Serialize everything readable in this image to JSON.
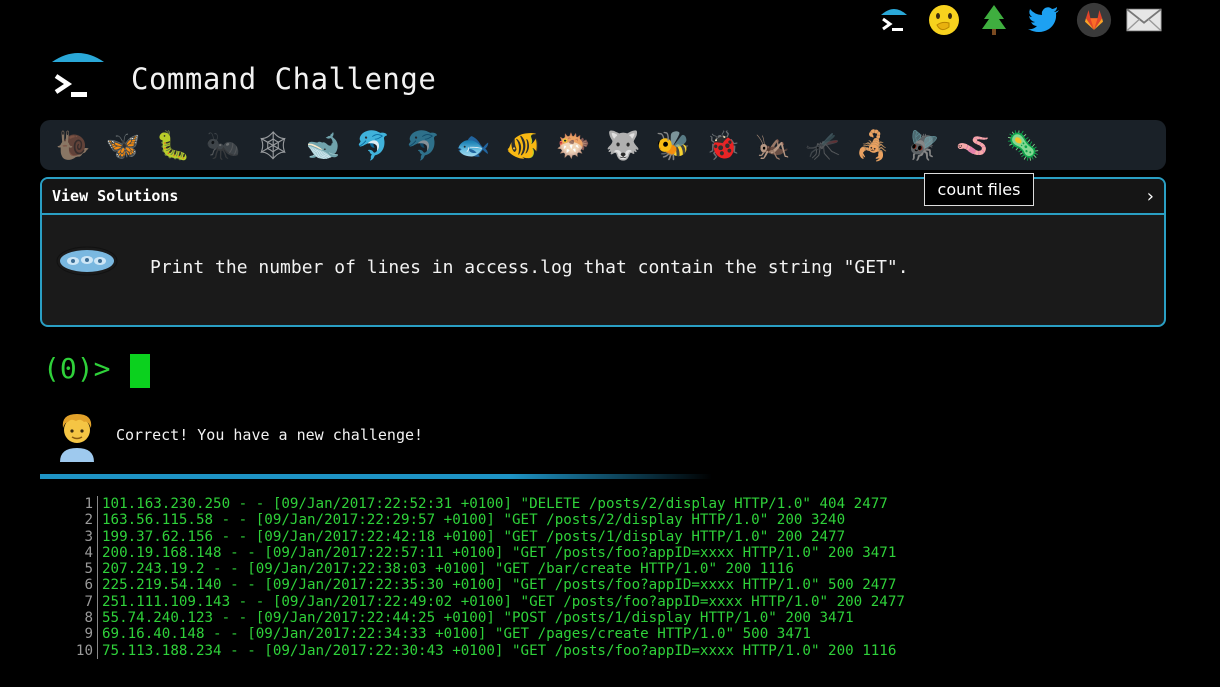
{
  "header": {
    "title": "Command Challenge"
  },
  "top_icons": [
    "terminal-icon",
    "face-with-hand-over-mouth-icon",
    "tree-icon",
    "twitter-icon",
    "gitlab-icon",
    "mail-icon"
  ],
  "animals": [
    "snail",
    "butterfly",
    "bug",
    "ant",
    "spider-web",
    "whale",
    "dolphin",
    "dolphin",
    "fish",
    "tropical-fish",
    "blowfish",
    "wolf",
    "bee",
    "ladybug",
    "cricket",
    "mosquito",
    "scorpion",
    "fly",
    "worm",
    "microbe"
  ],
  "solutions": {
    "label": "View Solutions",
    "chevron": "›",
    "tooltip": "count files"
  },
  "challenge": {
    "text": "Print the number of lines in access.log that contain the string \"GET\"."
  },
  "terminal": {
    "prompt": "(0)>"
  },
  "message": {
    "text": "Correct! You have a new challenge!"
  },
  "log_lines": [
    {
      "n": "1",
      "text": "101.163.230.250 - - [09/Jan/2017:22:52:31 +0100] \"DELETE /posts/2/display HTTP/1.0\" 404 2477"
    },
    {
      "n": "2",
      "text": "163.56.115.58 - - [09/Jan/2017:22:29:57 +0100] \"GET /posts/2/display HTTP/1.0\" 200 3240"
    },
    {
      "n": "3",
      "text": "199.37.62.156 - - [09/Jan/2017:22:42:18 +0100] \"GET /posts/1/display HTTP/1.0\" 200 2477"
    },
    {
      "n": "4",
      "text": "200.19.168.148 - - [09/Jan/2017:22:57:11 +0100] \"GET /posts/foo?appID=xxxx HTTP/1.0\" 200 3471"
    },
    {
      "n": "5",
      "text": "207.243.19.2 - - [09/Jan/2017:22:38:03 +0100] \"GET /bar/create HTTP/1.0\" 200 1116"
    },
    {
      "n": "6",
      "text": "225.219.54.140 - - [09/Jan/2017:22:35:30 +0100] \"GET /posts/foo?appID=xxxx HTTP/1.0\" 500 2477"
    },
    {
      "n": "7",
      "text": "251.111.109.143 - - [09/Jan/2017:22:49:02 +0100] \"GET /posts/foo?appID=xxxx HTTP/1.0\" 200 2477"
    },
    {
      "n": "8",
      "text": "55.74.240.123 - - [09/Jan/2017:22:44:25 +0100] \"POST /posts/1/display HTTP/1.0\" 200 3471"
    },
    {
      "n": "9",
      "text": "69.16.40.148 - - [09/Jan/2017:22:34:33 +0100] \"GET /pages/create HTTP/1.0\" 500 3471"
    },
    {
      "n": "10",
      "text": "75.113.188.234 - - [09/Jan/2017:22:30:43 +0100] \"GET /posts/foo?appID=xxxx HTTP/1.0\" 200 1116"
    }
  ],
  "colors": {
    "accent": "#2a9fc4",
    "terminal_green": "#2fd13a",
    "cursor": "#0bd11e",
    "panel_bg": "#1a1a1a",
    "bar_bg": "#1a2128"
  }
}
